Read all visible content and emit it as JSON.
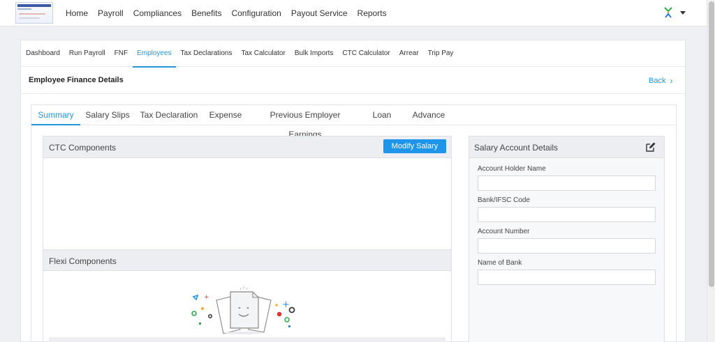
{
  "topnav": {
    "items": [
      "Home",
      "Payroll",
      "Compliances",
      "Benefits",
      "Configuration",
      "Payout Service",
      "Reports"
    ]
  },
  "subnav": {
    "items": [
      "Dashboard",
      "Run Payroll",
      "FNF",
      "Employees",
      "Tax Declarations",
      "Tax Calculator",
      "Bulk Imports",
      "CTC Calculator",
      "Arrear",
      "Trip Pay"
    ],
    "active": "Employees"
  },
  "page": {
    "title": "Employee Finance Details",
    "back_label": "Back"
  },
  "tabs": {
    "items": [
      "Summary",
      "Salary Slips",
      "Tax Declaration",
      "Expense",
      "Previous Employer Earnings",
      "Loan",
      "Advance"
    ],
    "active": "Summary"
  },
  "ctc": {
    "title": "CTC Components",
    "modify_label": "Modify Salary",
    "flexi_title": "Flexi Components"
  },
  "account": {
    "title": "Salary Account Details",
    "fields": [
      {
        "label": "Account Holder Name",
        "value": ""
      },
      {
        "label": "Bank/IFSC Code",
        "value": ""
      },
      {
        "label": "Account Number",
        "value": ""
      },
      {
        "label": "Name of Bank",
        "value": ""
      }
    ]
  },
  "colors": {
    "accent": "#2196d8",
    "button": "#1e95e8"
  }
}
